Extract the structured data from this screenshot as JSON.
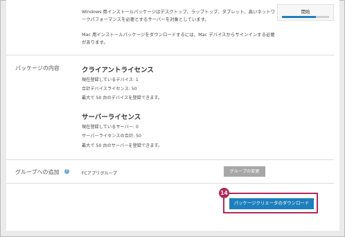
{
  "description": {
    "windows_text": "Windows 用インストールパッケージはデスクトップ、ラップトップ、タブレット、高いネットワークパフォーマンスを必要とするサーバーを対象としています。",
    "mac_text": "Mac 用インストールパッケージをダウンロードするには、Mac デバイスからサインインする必要があります。"
  },
  "status_panel": {
    "label": "開始",
    "progress": 0.72
  },
  "package_contents": {
    "section_label": "パッケージの内容",
    "client": {
      "title": "クライアントライセンス",
      "lines": [
        "現在登録しているデバイス: 1",
        "合計デバイスライセンス: 50",
        "最大で 50 台のデバイスを登録できます。"
      ]
    },
    "server": {
      "title": "サーバーライセンス",
      "lines": [
        "現在登録しているサーバー: 0",
        "サーバーライセンスの合計: 50",
        "最大で 50 台のサーバーを登録できます。"
      ]
    }
  },
  "group": {
    "section_label": "グループへの追加",
    "info_icon": "?",
    "name": "FCアプリグループ",
    "change_button": "グループの変更"
  },
  "download": {
    "callout_number": "14",
    "button_label": "パッケージクリエータのダウンロード"
  },
  "colors": {
    "accent": "#1e7fbd",
    "callout": "#b2265a",
    "disabled_button": "#a7a7a7"
  }
}
